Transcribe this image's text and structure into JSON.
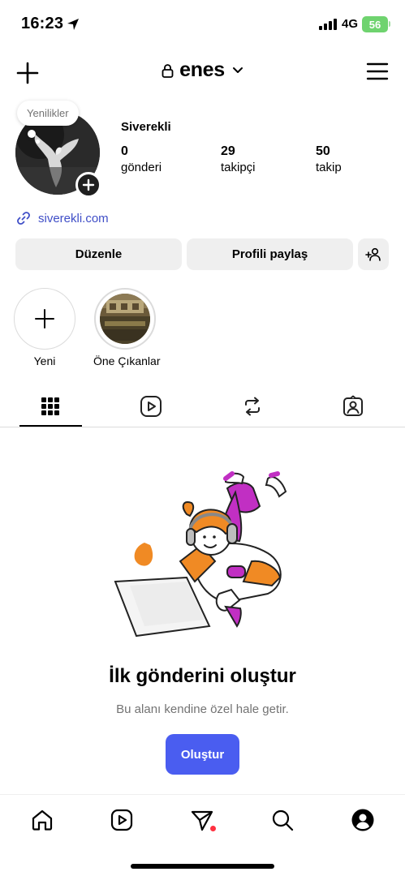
{
  "status_bar": {
    "time": "16:23",
    "network": "4G",
    "battery": "56"
  },
  "header": {
    "username": "enes"
  },
  "profile": {
    "notes_bubble": "Yenilikler",
    "display_name": "Siverekli",
    "stats": [
      {
        "value": "0",
        "label": "gönderi"
      },
      {
        "value": "29",
        "label": "takipçi"
      },
      {
        "value": "50",
        "label": "takip"
      }
    ],
    "link": "siverekli.com"
  },
  "actions": {
    "edit_label": "Düzenle",
    "share_label": "Profili paylaş"
  },
  "highlights": [
    {
      "label": "Yeni"
    },
    {
      "label": "Öne Çıkanlar"
    }
  ],
  "tabs": [
    "grid-icon",
    "reels-icon",
    "reposts-icon",
    "tagged-icon"
  ],
  "empty_state": {
    "title": "İlk gönderini oluştur",
    "subtitle": "Bu alanı kendine özel hale getir.",
    "button_label": "Oluştur"
  },
  "bottom_nav": [
    "home-icon",
    "reels-icon",
    "messages-icon",
    "search-icon",
    "profile-icon"
  ],
  "colors": {
    "accent": "#4a5df0",
    "link": "#3f4ec7",
    "button_bg": "#efefef",
    "notification_dot": "#ff3040"
  }
}
